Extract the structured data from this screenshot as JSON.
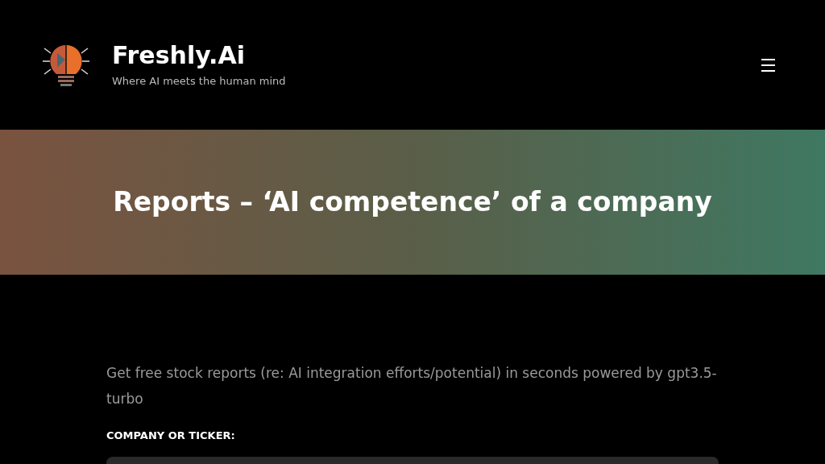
{
  "header": {
    "brand": "Freshly.Ai",
    "tagline": "Where AI meets the human mind"
  },
  "hero": {
    "title": "Reports – ‘AI competence’ of a company"
  },
  "form": {
    "intro": "Get free stock reports (re: AI integration efforts/potential) in seconds powered by gpt3.5-turbo",
    "field_label": "COMPANY OR TICKER:"
  }
}
